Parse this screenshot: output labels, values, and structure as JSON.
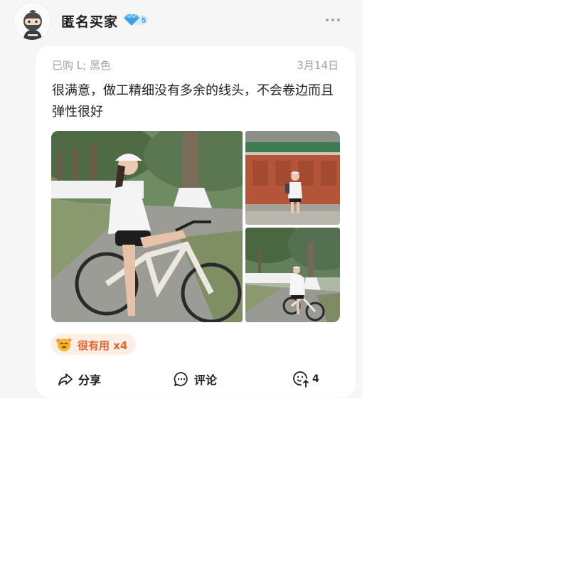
{
  "user": {
    "name": "匿名买家",
    "level": "5",
    "avatar_icon": "ninja-avatar-icon"
  },
  "review": {
    "spec": "已购 L; 黑色",
    "date": "3月14日",
    "text": "很满意，做工精细没有多余的线头，不会卷边而且弹性很好"
  },
  "photos": [
    {
      "name": "bike-rider-photo"
    },
    {
      "name": "red-wall-photo"
    },
    {
      "name": "tree-road-photo"
    }
  ],
  "helpful": {
    "label": "很有用 x4",
    "icon": "laughing-face-icon"
  },
  "actions": {
    "share_label": "分享",
    "comment_label": "评论",
    "like_count": "4"
  },
  "colors": {
    "accent": "#e1662f",
    "tag_bg": "#fdeee6",
    "badge": "#5ab3ea"
  }
}
